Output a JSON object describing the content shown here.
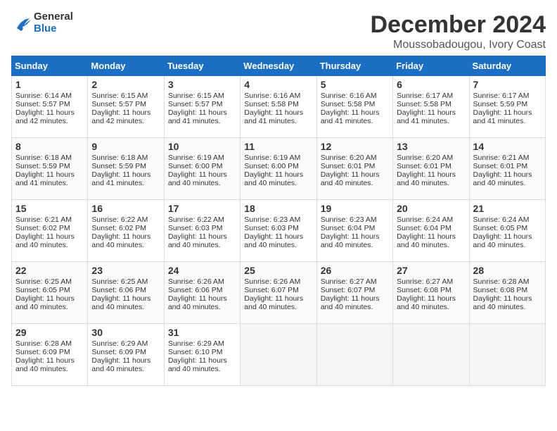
{
  "logo": {
    "general": "General",
    "blue": "Blue"
  },
  "title": "December 2024",
  "location": "Moussobadougou, Ivory Coast",
  "days_of_week": [
    "Sunday",
    "Monday",
    "Tuesday",
    "Wednesday",
    "Thursday",
    "Friday",
    "Saturday"
  ],
  "weeks": [
    [
      {
        "day": 1,
        "lines": [
          "Sunrise: 6:14 AM",
          "Sunset: 5:57 PM",
          "Daylight: 11 hours",
          "and 42 minutes."
        ]
      },
      {
        "day": 2,
        "lines": [
          "Sunrise: 6:15 AM",
          "Sunset: 5:57 PM",
          "Daylight: 11 hours",
          "and 42 minutes."
        ]
      },
      {
        "day": 3,
        "lines": [
          "Sunrise: 6:15 AM",
          "Sunset: 5:57 PM",
          "Daylight: 11 hours",
          "and 41 minutes."
        ]
      },
      {
        "day": 4,
        "lines": [
          "Sunrise: 6:16 AM",
          "Sunset: 5:58 PM",
          "Daylight: 11 hours",
          "and 41 minutes."
        ]
      },
      {
        "day": 5,
        "lines": [
          "Sunrise: 6:16 AM",
          "Sunset: 5:58 PM",
          "Daylight: 11 hours",
          "and 41 minutes."
        ]
      },
      {
        "day": 6,
        "lines": [
          "Sunrise: 6:17 AM",
          "Sunset: 5:58 PM",
          "Daylight: 11 hours",
          "and 41 minutes."
        ]
      },
      {
        "day": 7,
        "lines": [
          "Sunrise: 6:17 AM",
          "Sunset: 5:59 PM",
          "Daylight: 11 hours",
          "and 41 minutes."
        ]
      }
    ],
    [
      {
        "day": 8,
        "lines": [
          "Sunrise: 6:18 AM",
          "Sunset: 5:59 PM",
          "Daylight: 11 hours",
          "and 41 minutes."
        ]
      },
      {
        "day": 9,
        "lines": [
          "Sunrise: 6:18 AM",
          "Sunset: 5:59 PM",
          "Daylight: 11 hours",
          "and 41 minutes."
        ]
      },
      {
        "day": 10,
        "lines": [
          "Sunrise: 6:19 AM",
          "Sunset: 6:00 PM",
          "Daylight: 11 hours",
          "and 40 minutes."
        ]
      },
      {
        "day": 11,
        "lines": [
          "Sunrise: 6:19 AM",
          "Sunset: 6:00 PM",
          "Daylight: 11 hours",
          "and 40 minutes."
        ]
      },
      {
        "day": 12,
        "lines": [
          "Sunrise: 6:20 AM",
          "Sunset: 6:01 PM",
          "Daylight: 11 hours",
          "and 40 minutes."
        ]
      },
      {
        "day": 13,
        "lines": [
          "Sunrise: 6:20 AM",
          "Sunset: 6:01 PM",
          "Daylight: 11 hours",
          "and 40 minutes."
        ]
      },
      {
        "day": 14,
        "lines": [
          "Sunrise: 6:21 AM",
          "Sunset: 6:01 PM",
          "Daylight: 11 hours",
          "and 40 minutes."
        ]
      }
    ],
    [
      {
        "day": 15,
        "lines": [
          "Sunrise: 6:21 AM",
          "Sunset: 6:02 PM",
          "Daylight: 11 hours",
          "and 40 minutes."
        ]
      },
      {
        "day": 16,
        "lines": [
          "Sunrise: 6:22 AM",
          "Sunset: 6:02 PM",
          "Daylight: 11 hours",
          "and 40 minutes."
        ]
      },
      {
        "day": 17,
        "lines": [
          "Sunrise: 6:22 AM",
          "Sunset: 6:03 PM",
          "Daylight: 11 hours",
          "and 40 minutes."
        ]
      },
      {
        "day": 18,
        "lines": [
          "Sunrise: 6:23 AM",
          "Sunset: 6:03 PM",
          "Daylight: 11 hours",
          "and 40 minutes."
        ]
      },
      {
        "day": 19,
        "lines": [
          "Sunrise: 6:23 AM",
          "Sunset: 6:04 PM",
          "Daylight: 11 hours",
          "and 40 minutes."
        ]
      },
      {
        "day": 20,
        "lines": [
          "Sunrise: 6:24 AM",
          "Sunset: 6:04 PM",
          "Daylight: 11 hours",
          "and 40 minutes."
        ]
      },
      {
        "day": 21,
        "lines": [
          "Sunrise: 6:24 AM",
          "Sunset: 6:05 PM",
          "Daylight: 11 hours",
          "and 40 minutes."
        ]
      }
    ],
    [
      {
        "day": 22,
        "lines": [
          "Sunrise: 6:25 AM",
          "Sunset: 6:05 PM",
          "Daylight: 11 hours",
          "and 40 minutes."
        ]
      },
      {
        "day": 23,
        "lines": [
          "Sunrise: 6:25 AM",
          "Sunset: 6:06 PM",
          "Daylight: 11 hours",
          "and 40 minutes."
        ]
      },
      {
        "day": 24,
        "lines": [
          "Sunrise: 6:26 AM",
          "Sunset: 6:06 PM",
          "Daylight: 11 hours",
          "and 40 minutes."
        ]
      },
      {
        "day": 25,
        "lines": [
          "Sunrise: 6:26 AM",
          "Sunset: 6:07 PM",
          "Daylight: 11 hours",
          "and 40 minutes."
        ]
      },
      {
        "day": 26,
        "lines": [
          "Sunrise: 6:27 AM",
          "Sunset: 6:07 PM",
          "Daylight: 11 hours",
          "and 40 minutes."
        ]
      },
      {
        "day": 27,
        "lines": [
          "Sunrise: 6:27 AM",
          "Sunset: 6:08 PM",
          "Daylight: 11 hours",
          "and 40 minutes."
        ]
      },
      {
        "day": 28,
        "lines": [
          "Sunrise: 6:28 AM",
          "Sunset: 6:08 PM",
          "Daylight: 11 hours",
          "and 40 minutes."
        ]
      }
    ],
    [
      {
        "day": 29,
        "lines": [
          "Sunrise: 6:28 AM",
          "Sunset: 6:09 PM",
          "Daylight: 11 hours",
          "and 40 minutes."
        ]
      },
      {
        "day": 30,
        "lines": [
          "Sunrise: 6:29 AM",
          "Sunset: 6:09 PM",
          "Daylight: 11 hours",
          "and 40 minutes."
        ]
      },
      {
        "day": 31,
        "lines": [
          "Sunrise: 6:29 AM",
          "Sunset: 6:10 PM",
          "Daylight: 11 hours",
          "and 40 minutes."
        ]
      },
      null,
      null,
      null,
      null
    ]
  ]
}
